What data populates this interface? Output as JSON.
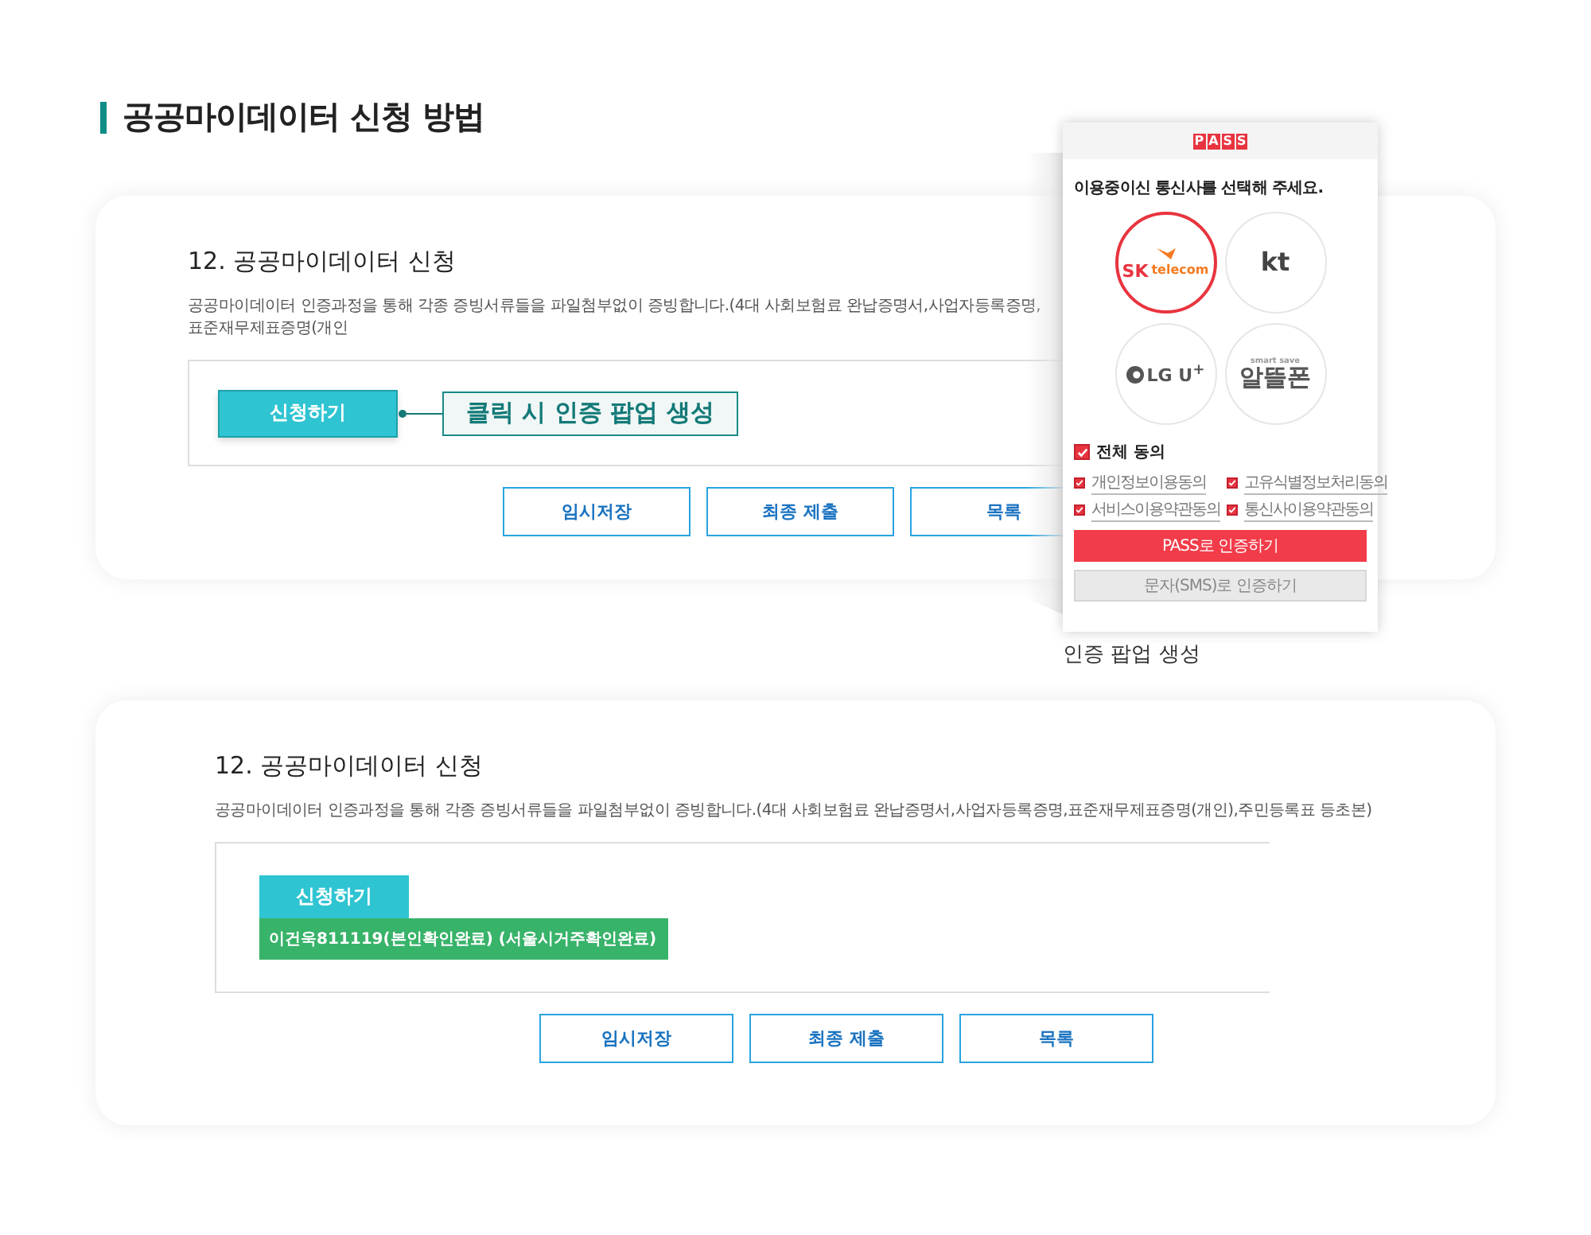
{
  "page_title": "공공마이데이터 신청 방법",
  "steps": [
    {
      "kind": "callout",
      "title": "12. 공공마이데이터 신청",
      "description": "공공마이데이터 인증과정을 통해 각종 증빙서류들을 파일첨부없이 증빙합니다.(4대 사회보험료 완납증명서,사업자등록증명,표준재무제표증명(개인",
      "apply_button": "신청하기",
      "callout": "클릭 시 인증 팝업 생성",
      "actions": [
        "임시저장",
        "최종 제출",
        "목록"
      ]
    },
    {
      "kind": "result",
      "title": "12. 공공마이데이터 신청",
      "description": "공공마이데이터 인증과정을 통해 각종 증빙서류들을 파일첨부없이 증빙합니다.(4대 사회보험료 완납증명서,사업자등록증명,표준재무제표증명(개인),주민등록표 등초본)",
      "apply_button": "신청하기",
      "result": "이건욱811119(본인확인완료) (서울시거주확인완료)",
      "actions": [
        "임시저장",
        "최종 제출",
        "목록"
      ]
    }
  ],
  "popup": {
    "brand": [
      "P",
      "A",
      "S",
      "S"
    ],
    "prompt": "이용중이신 통신사를 선택해 주세요.",
    "carriers": [
      {
        "kind": "skt",
        "name": "SK",
        "sub": "telecom",
        "selected": true
      },
      {
        "kind": "kt",
        "name": "kt",
        "selected": false
      },
      {
        "kind": "lg",
        "name": "LG U$^{+}$",
        "selected": false
      },
      {
        "kind": "mvno",
        "name": "알뜰폰",
        "sub": "smart save",
        "selected": false
      }
    ],
    "agree_all": {
      "label": "전체 동의",
      "checked": true
    },
    "agreements": [
      {
        "label": "개인정보이용동의",
        "checked": true
      },
      {
        "label": "고유식별정보처리동의",
        "checked": true
      },
      {
        "label": "서비스이용약관동의",
        "checked": true
      },
      {
        "label": "통신사이용약관동의",
        "checked": true
      }
    ],
    "buttons": [
      {
        "label": "PASS로 인증하기",
        "kind": "primary"
      },
      {
        "label": "문자(SMS)로 인증하기",
        "kind": "secondary"
      }
    ],
    "caption": "인증 팝업 생성"
  }
}
